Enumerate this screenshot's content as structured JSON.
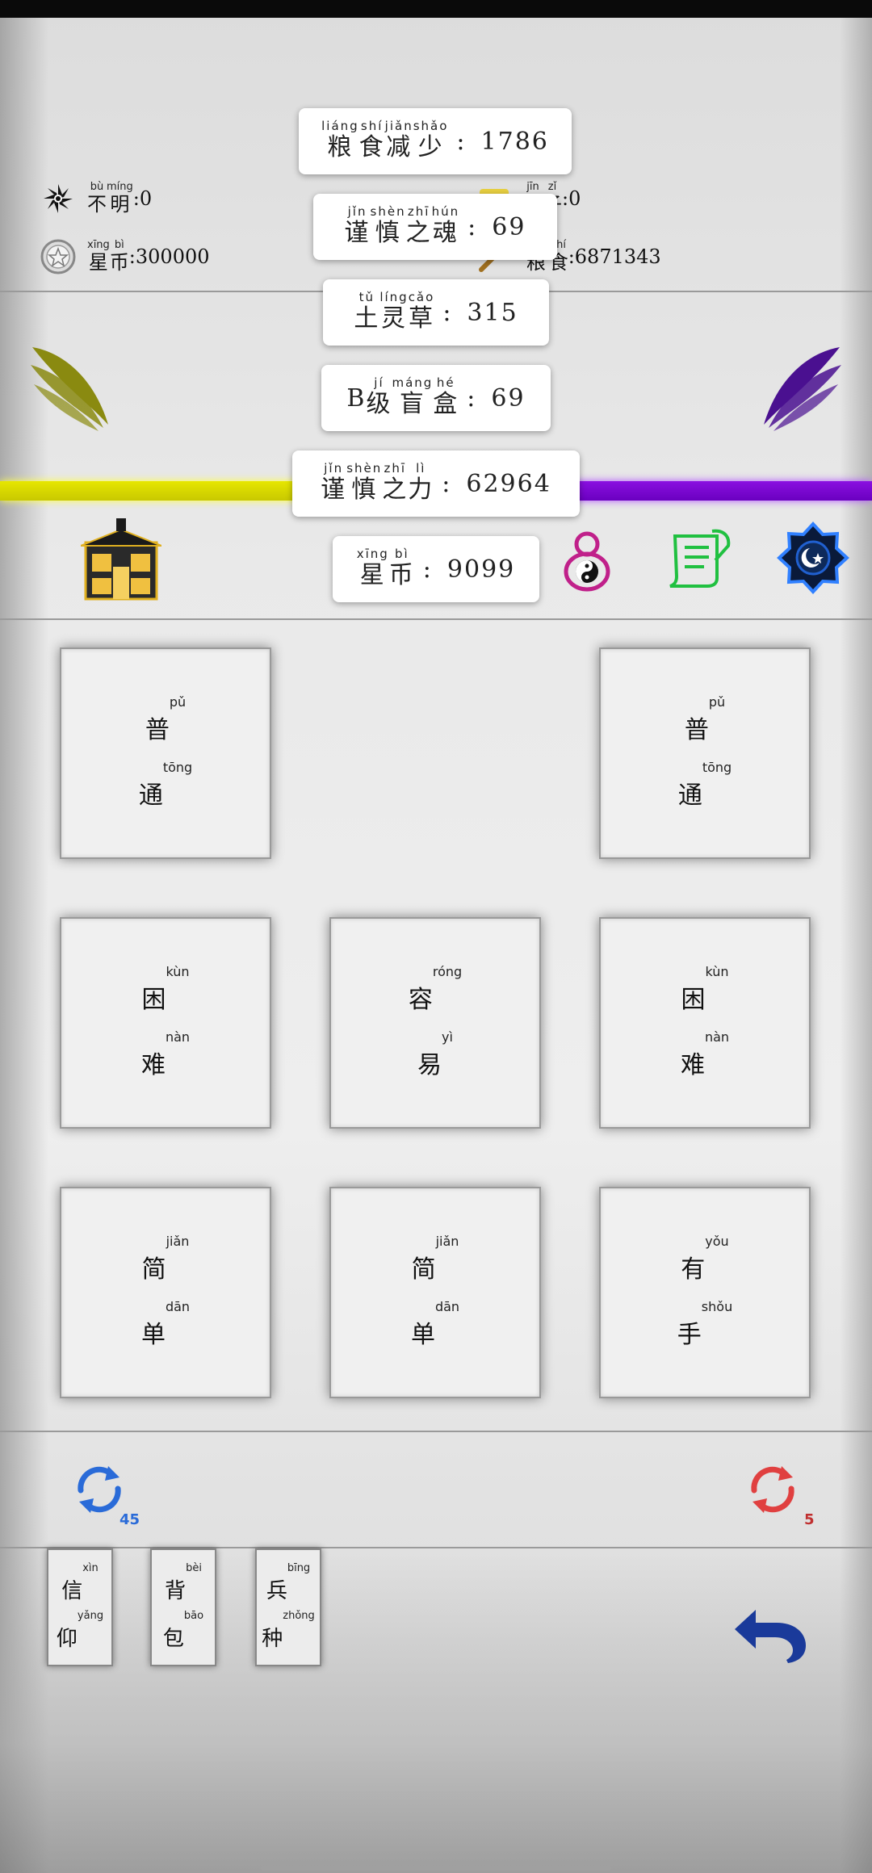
{
  "resources": {
    "bum": {
      "label_ruby": [
        [
          "不",
          "bù"
        ],
        [
          "明",
          "míng"
        ]
      ],
      "value": ":0"
    },
    "jinzi": {
      "label_ruby": [
        [
          "金",
          "jīn"
        ],
        [
          "子",
          "zǐ"
        ]
      ],
      "value": ":0",
      "visible": "子:0"
    },
    "xingbi": {
      "label_ruby": [
        [
          "星",
          "xīng"
        ],
        [
          "币",
          "bì"
        ]
      ],
      "value": ":300000"
    },
    "liangshi": {
      "label_ruby": [
        [
          "粮",
          "liáng"
        ],
        [
          "食",
          "shí"
        ]
      ],
      "value": ":6871343",
      "visible": "食:6871343"
    }
  },
  "toasts": [
    {
      "ruby": [
        [
          "粮",
          "liáng"
        ],
        [
          "食",
          "shí"
        ],
        [
          "减",
          "jiǎn"
        ],
        [
          "少",
          "shǎo"
        ]
      ],
      "value": "1786"
    },
    {
      "ruby": [
        [
          "谨",
          "jǐn"
        ],
        [
          "慎",
          "shèn"
        ],
        [
          "之",
          "zhī"
        ],
        [
          "魂",
          "hún"
        ]
      ],
      "value": "69"
    },
    {
      "ruby": [
        [
          "土",
          "tǔ"
        ],
        [
          "灵",
          "líng"
        ],
        [
          "草",
          "cǎo"
        ]
      ],
      "value": "315"
    },
    {
      "prefix": "B",
      "ruby": [
        [
          "级",
          "jí"
        ],
        [
          "盲",
          "máng"
        ],
        [
          "盒",
          "hé"
        ]
      ],
      "value": "69"
    },
    {
      "ruby": [
        [
          "谨",
          "jǐn"
        ],
        [
          "慎",
          "shèn"
        ],
        [
          "之",
          "zhī"
        ],
        [
          "力",
          "lì"
        ]
      ],
      "value": "62964"
    },
    {
      "ruby": [
        [
          "星",
          "xīng"
        ],
        [
          "币",
          "bì"
        ]
      ],
      "value": "9099"
    }
  ],
  "cards": [
    {
      "slot": 0,
      "chars": [
        [
          "普",
          "pǔ"
        ],
        [
          "通",
          "tōng"
        ]
      ]
    },
    {
      "slot": 1,
      "chars": []
    },
    {
      "slot": 2,
      "chars": [
        [
          "普",
          "pǔ"
        ],
        [
          "通",
          "tōng"
        ]
      ]
    },
    {
      "slot": 3,
      "chars": [
        [
          "困",
          "kùn"
        ],
        [
          "难",
          "nàn"
        ]
      ]
    },
    {
      "slot": 4,
      "chars": [
        [
          "容",
          "róng"
        ],
        [
          "易",
          "yì"
        ]
      ]
    },
    {
      "slot": 5,
      "chars": [
        [
          "困",
          "kùn"
        ],
        [
          "难",
          "nàn"
        ]
      ]
    },
    {
      "slot": 6,
      "chars": [
        [
          "简",
          "jiǎn"
        ],
        [
          "单",
          "dān"
        ]
      ]
    },
    {
      "slot": 7,
      "chars": [
        [
          "简",
          "jiǎn"
        ],
        [
          "单",
          "dān"
        ]
      ]
    },
    {
      "slot": 8,
      "chars": [
        [
          "有",
          "yǒu"
        ],
        [
          "手",
          "shǒu"
        ]
      ]
    }
  ],
  "refresh": {
    "blue_count": "45",
    "red_count": "5"
  },
  "bottom_slots": [
    {
      "chars": [
        [
          "信",
          "xìn"
        ],
        [
          "仰",
          "yǎng"
        ]
      ]
    },
    {
      "chars": [
        [
          "背",
          "bèi"
        ],
        [
          "包",
          "bāo"
        ]
      ]
    },
    {
      "chars": [
        [
          "兵",
          "bīng"
        ],
        [
          "种",
          "zhǒng"
        ]
      ]
    }
  ],
  "colors": {
    "yellow_bar": "#e6e600",
    "purple_bar": "#8a10e0",
    "blue_icon": "#2a6bd8",
    "red_icon": "#e04040",
    "back_icon": "#1a3a9a"
  },
  "icons": [
    "pinwheel-icon",
    "star-coin-icon",
    "gold-icon",
    "wing-left-icon",
    "wing-right-icon",
    "shop-icon",
    "gourd-icon",
    "scroll-icon",
    "star-badge-icon",
    "refresh-blue-icon",
    "refresh-red-icon",
    "back-arrow-icon"
  ]
}
